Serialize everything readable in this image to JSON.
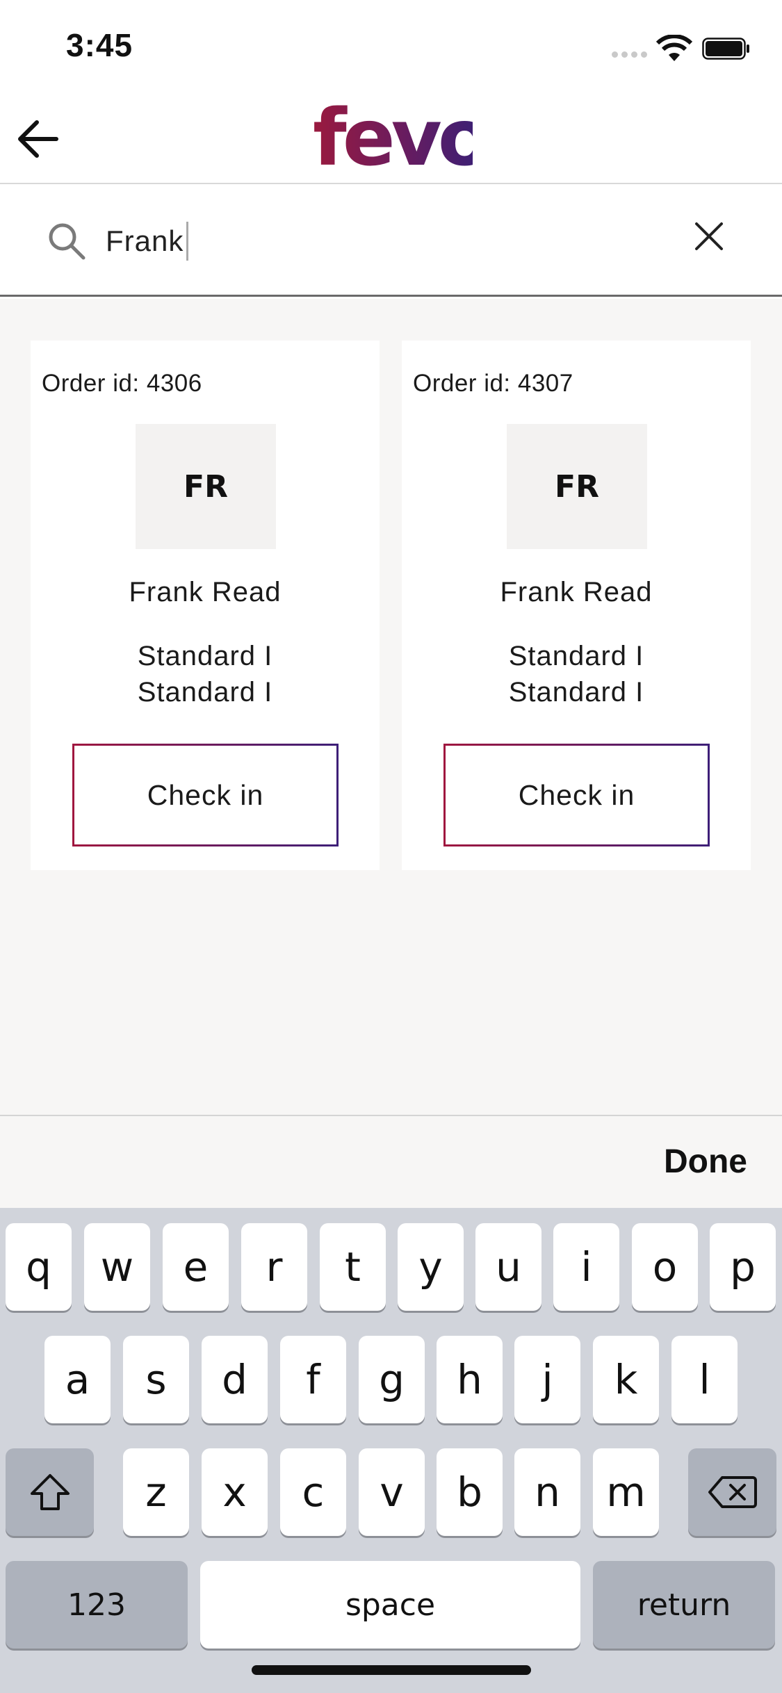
{
  "status_bar": {
    "time": "3:45"
  },
  "header": {
    "logo_text": "fevo",
    "brand_colors": [
      "#9a1a3e",
      "#3f1f73"
    ]
  },
  "search": {
    "value": "Frank",
    "placeholder": ""
  },
  "orders": [
    {
      "order_label": "Order id: 4306",
      "initials": "FR",
      "name": "Frank Read",
      "tickets": [
        "Standard I",
        "Standard I"
      ],
      "button": "Check in"
    },
    {
      "order_label": "Order id: 4307",
      "initials": "FR",
      "name": "Frank Read",
      "tickets": [
        "Standard I",
        "Standard I"
      ],
      "button": "Check in"
    }
  ],
  "keyboard": {
    "done": "Done",
    "row1": [
      "q",
      "w",
      "e",
      "r",
      "t",
      "y",
      "u",
      "i",
      "o",
      "p"
    ],
    "row2": [
      "a",
      "s",
      "d",
      "f",
      "g",
      "h",
      "j",
      "k",
      "l"
    ],
    "row3": [
      "z",
      "x",
      "c",
      "v",
      "b",
      "n",
      "m"
    ],
    "numbers": "123",
    "space": "space",
    "return": "return"
  }
}
